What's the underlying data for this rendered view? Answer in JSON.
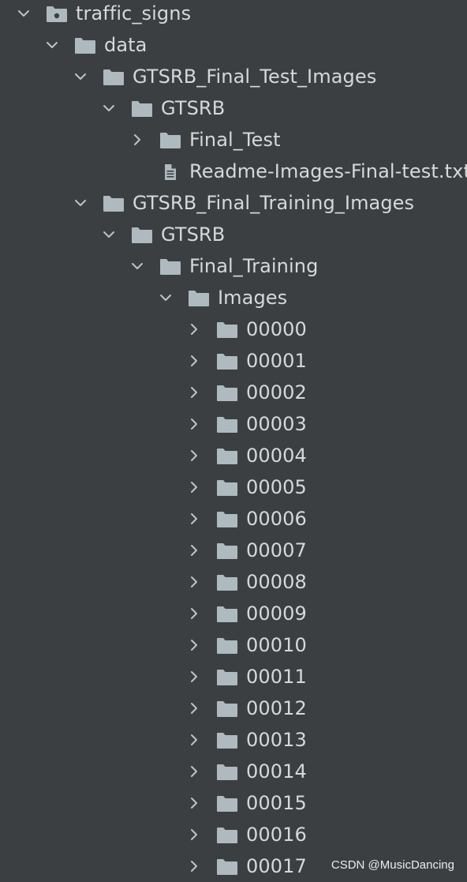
{
  "tree": [
    {
      "label": "traffic_signs",
      "depth": 0,
      "state": "expanded",
      "icon": "module-folder-icon"
    },
    {
      "label": "data",
      "depth": 1,
      "state": "expanded",
      "icon": "folder-icon"
    },
    {
      "label": "GTSRB_Final_Test_Images",
      "depth": 2,
      "state": "expanded",
      "icon": "folder-icon"
    },
    {
      "label": "GTSRB",
      "depth": 3,
      "state": "expanded",
      "icon": "folder-icon"
    },
    {
      "label": "Final_Test",
      "depth": 4,
      "state": "collapsed",
      "icon": "folder-icon"
    },
    {
      "label": "Readme-Images-Final-test.txt",
      "depth": 4,
      "state": "leaf",
      "icon": "text-file-icon"
    },
    {
      "label": "GTSRB_Final_Training_Images",
      "depth": 2,
      "state": "expanded",
      "icon": "folder-icon"
    },
    {
      "label": "GTSRB",
      "depth": 3,
      "state": "expanded",
      "icon": "folder-icon"
    },
    {
      "label": "Final_Training",
      "depth": 4,
      "state": "expanded",
      "icon": "folder-icon"
    },
    {
      "label": "Images",
      "depth": 5,
      "state": "expanded",
      "icon": "folder-icon"
    },
    {
      "label": "00000",
      "depth": 6,
      "state": "collapsed",
      "icon": "folder-icon"
    },
    {
      "label": "00001",
      "depth": 6,
      "state": "collapsed",
      "icon": "folder-icon"
    },
    {
      "label": "00002",
      "depth": 6,
      "state": "collapsed",
      "icon": "folder-icon"
    },
    {
      "label": "00003",
      "depth": 6,
      "state": "collapsed",
      "icon": "folder-icon"
    },
    {
      "label": "00004",
      "depth": 6,
      "state": "collapsed",
      "icon": "folder-icon"
    },
    {
      "label": "00005",
      "depth": 6,
      "state": "collapsed",
      "icon": "folder-icon"
    },
    {
      "label": "00006",
      "depth": 6,
      "state": "collapsed",
      "icon": "folder-icon"
    },
    {
      "label": "00007",
      "depth": 6,
      "state": "collapsed",
      "icon": "folder-icon"
    },
    {
      "label": "00008",
      "depth": 6,
      "state": "collapsed",
      "icon": "folder-icon"
    },
    {
      "label": "00009",
      "depth": 6,
      "state": "collapsed",
      "icon": "folder-icon"
    },
    {
      "label": "00010",
      "depth": 6,
      "state": "collapsed",
      "icon": "folder-icon"
    },
    {
      "label": "00011",
      "depth": 6,
      "state": "collapsed",
      "icon": "folder-icon"
    },
    {
      "label": "00012",
      "depth": 6,
      "state": "collapsed",
      "icon": "folder-icon"
    },
    {
      "label": "00013",
      "depth": 6,
      "state": "collapsed",
      "icon": "folder-icon"
    },
    {
      "label": "00014",
      "depth": 6,
      "state": "collapsed",
      "icon": "folder-icon"
    },
    {
      "label": "00015",
      "depth": 6,
      "state": "collapsed",
      "icon": "folder-icon"
    },
    {
      "label": "00016",
      "depth": 6,
      "state": "collapsed",
      "icon": "folder-icon"
    },
    {
      "label": "00017",
      "depth": 6,
      "state": "collapsed",
      "icon": "folder-icon"
    }
  ],
  "watermark": "CSDN @MusicDancing",
  "colors": {
    "background": "#3c3f41",
    "text": "#d6d8da",
    "folder": "#aeb9c0",
    "chevron": "#c0c2c4"
  }
}
